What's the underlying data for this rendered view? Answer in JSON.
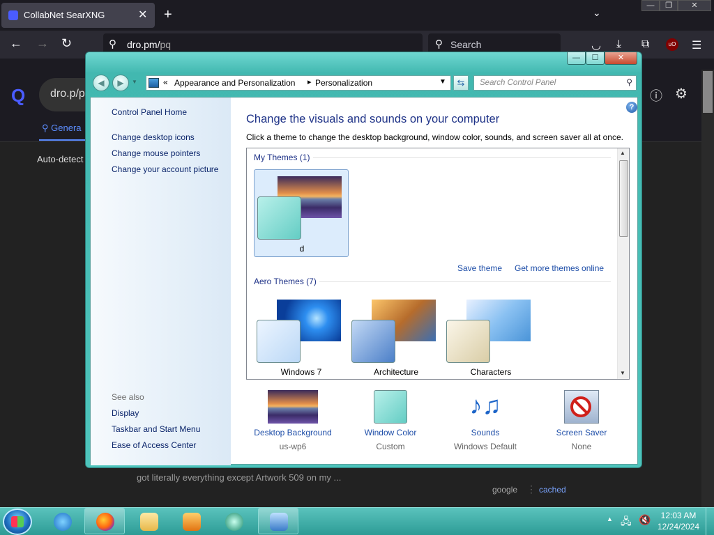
{
  "browser": {
    "tab_title": "CollabNet SearXNG",
    "tab_close": "✕",
    "new_tab": "+",
    "url_host": "dro.pm/",
    "url_path": "pq",
    "search_placeholder": "Search"
  },
  "page": {
    "query_text": "dro.p/p",
    "tab_general": "Genera",
    "auto_detect": "Auto-detect",
    "snippet": "got literally everything except Artwork 509 on my ...",
    "source": "google",
    "separator": "⋮",
    "cached": "cached"
  },
  "window": {
    "caption_min": "—",
    "caption_max": "☐",
    "caption_close": "✕",
    "address": {
      "prefix": "«",
      "crumb1": "Appearance and Personalization",
      "sep": "▸",
      "crumb2": "Personalization"
    },
    "search_placeholder": "Search Control Panel",
    "left_pane": {
      "home": "Control Panel Home",
      "tasks": [
        "Change desktop icons",
        "Change mouse pointers",
        "Change your account picture"
      ],
      "see_also_label": "See also",
      "see_also": [
        "Display",
        "Taskbar and Start Menu",
        "Ease of Access Center"
      ]
    },
    "heading": "Change the visuals and sounds on your computer",
    "subheading": "Click a theme to change the desktop background, window color, sounds, and screen saver all at once.",
    "my_themes_label": "My Themes (1)",
    "my_themes": [
      {
        "name": "d",
        "selected": true
      }
    ],
    "save_theme": "Save theme",
    "get_more": "Get more themes online",
    "aero_label": "Aero Themes (7)",
    "aero_themes": [
      {
        "name": "Windows 7"
      },
      {
        "name": "Architecture"
      },
      {
        "name": "Characters"
      }
    ],
    "bottom": [
      {
        "label": "Desktop Background",
        "value": "us-wp6"
      },
      {
        "label": "Window Color",
        "value": "Custom"
      },
      {
        "label": "Sounds",
        "value": "Windows Default"
      },
      {
        "label": "Screen Saver",
        "value": "None"
      }
    ]
  },
  "taskbar": {
    "clock_time": "12:03 AM",
    "clock_date": "12/24/2024"
  },
  "colors": {
    "window_frame": "#4ec4bc",
    "link": "#1e4ea8",
    "heading": "#1e3287",
    "taskbar": "#2d9b95"
  },
  "icons": [
    "search-icon",
    "back-icon",
    "forward-icon",
    "reload-icon",
    "pocket-icon",
    "download-icon",
    "extensions-icon",
    "ublock-icon",
    "menu-icon",
    "help-icon",
    "refresh-icon",
    "start-orb-icon",
    "ie-icon",
    "firefox-icon",
    "explorer-icon",
    "media-player-icon",
    "media-center-icon",
    "control-panel-icon",
    "network-icon",
    "volume-muted-icon"
  ]
}
